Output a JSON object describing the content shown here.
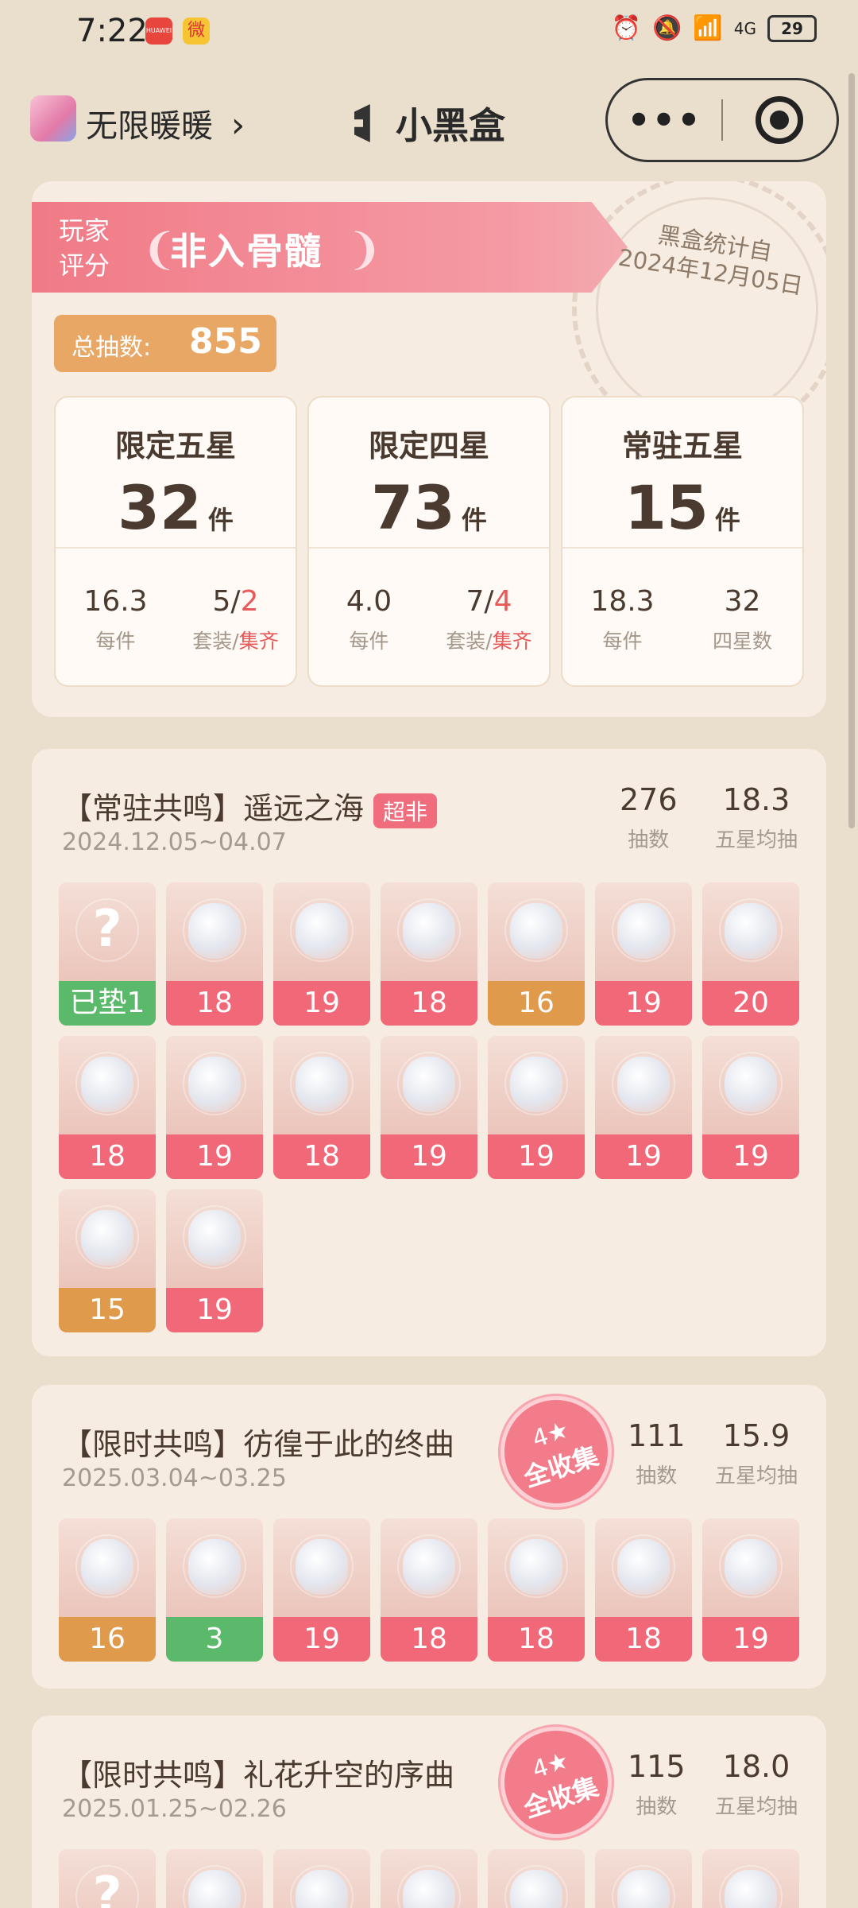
{
  "status_bar": {
    "time": "7:22",
    "app1": "HUAWEI",
    "app2": "微",
    "signal": "4G",
    "battery": "29"
  },
  "header": {
    "app_name": "无限暖暖",
    "chevron": "›",
    "brand": "小黑盒",
    "more": "•••"
  },
  "summary": {
    "rating_label": "玩家\n评分",
    "rating_value": "非入骨髓",
    "stamp_line1": "黑盒统计自",
    "stamp_line2": "2024年12月05日",
    "total_label": "总抽数:",
    "total_value": "855",
    "stats": [
      {
        "title": "限定五星",
        "count": "32",
        "unit": "件",
        "left_value": "16.3",
        "left_label": "每件",
        "right_value_a": "5/",
        "right_value_b": "2",
        "right_label_a": "套装/",
        "right_label_b": "集齐"
      },
      {
        "title": "限定四星",
        "count": "73",
        "unit": "件",
        "left_value": "4.0",
        "left_label": "每件",
        "right_value_a": "7/",
        "right_value_b": "4",
        "right_label_a": "套装/",
        "right_label_b": "集齐"
      },
      {
        "title": "常驻五星",
        "count": "15",
        "unit": "件",
        "left_value": "18.3",
        "left_label": "每件",
        "right_value_a": "32",
        "right_value_b": "",
        "right_label_a": "四星数",
        "right_label_b": ""
      }
    ]
  },
  "banners": [
    {
      "title": "【常驻共鸣】遥远之海",
      "tag": "超非",
      "date": "2024.12.05~04.07",
      "pulls": "276",
      "pulls_label": "抽数",
      "avg": "18.3",
      "avg_label": "五星均抽",
      "items": [
        {
          "label": "已垫1",
          "color": "green",
          "mystery": true
        },
        {
          "label": "18",
          "color": "red"
        },
        {
          "label": "19",
          "color": "red"
        },
        {
          "label": "18",
          "color": "red"
        },
        {
          "label": "16",
          "color": "orange"
        },
        {
          "label": "19",
          "color": "red"
        },
        {
          "label": "20",
          "color": "red"
        },
        {
          "label": "18",
          "color": "red"
        },
        {
          "label": "19",
          "color": "red"
        },
        {
          "label": "18",
          "color": "red"
        },
        {
          "label": "19",
          "color": "red"
        },
        {
          "label": "19",
          "color": "red"
        },
        {
          "label": "19",
          "color": "red"
        },
        {
          "label": "19",
          "color": "red"
        },
        {
          "label": "15",
          "color": "orange"
        },
        {
          "label": "19",
          "color": "red"
        }
      ]
    },
    {
      "title": "【限时共鸣】彷徨于此的终曲",
      "badge_top": "4★",
      "badge_bottom": "全收集",
      "date": "2025.03.04~03.25",
      "pulls": "111",
      "pulls_label": "抽数",
      "avg": "15.9",
      "avg_label": "五星均抽",
      "items": [
        {
          "label": "16",
          "color": "orange"
        },
        {
          "label": "3",
          "color": "green"
        },
        {
          "label": "19",
          "color": "red"
        },
        {
          "label": "18",
          "color": "red"
        },
        {
          "label": "18",
          "color": "red"
        },
        {
          "label": "18",
          "color": "red"
        },
        {
          "label": "19",
          "color": "red"
        }
      ]
    },
    {
      "title": "【限时共鸣】礼花升空的序曲",
      "badge_top": "4★",
      "badge_bottom": "全收集",
      "date": "2025.01.25~02.26",
      "pulls": "115",
      "pulls_label": "抽数",
      "avg": "18.0",
      "avg_label": "五星均抽",
      "items": [
        {
          "label": "",
          "mystery": true
        },
        {
          "label": ""
        },
        {
          "label": ""
        },
        {
          "label": ""
        },
        {
          "label": ""
        },
        {
          "label": ""
        },
        {
          "label": ""
        }
      ]
    }
  ],
  "colors": {
    "accent_red": "#f16878",
    "accent_orange": "#e09a4c",
    "accent_green": "#5ab96a",
    "card_bg": "#f6ece1",
    "page_bg": "#eadfcc"
  }
}
